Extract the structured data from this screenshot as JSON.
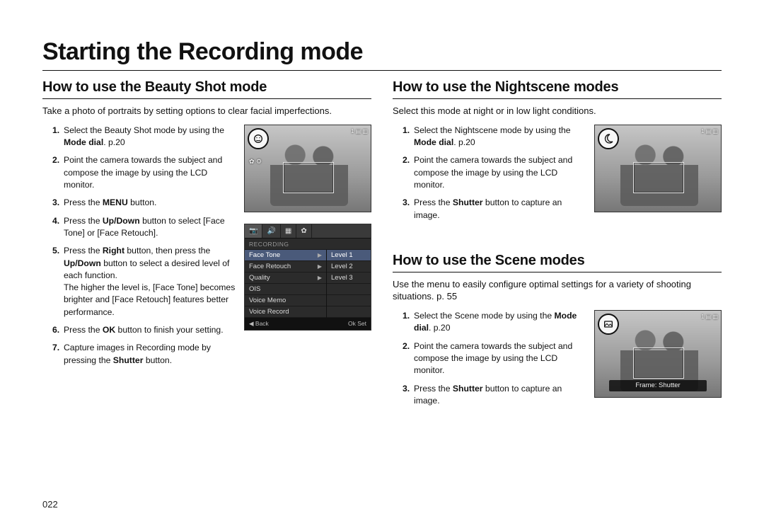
{
  "page_title": "Starting the Recording mode",
  "page_number": "022",
  "left": {
    "h2": "How to use the Beauty Shot mode",
    "intro": "Take a photo of portraits by setting options to clear facial imperfections.",
    "steps": [
      {
        "n": "1.",
        "pre": "Select the Beauty Shot mode by using the ",
        "b": "Mode dial",
        "post": ". p.20"
      },
      {
        "n": "2.",
        "pre": "Point the camera towards the subject and compose the image by using the LCD monitor.",
        "b": "",
        "post": ""
      },
      {
        "n": "3.",
        "pre": "Press the ",
        "b": "MENU",
        "post": " button."
      },
      {
        "n": "4.",
        "pre": "Press the ",
        "b": "Up/Down",
        "post": " button to select [Face Tone] or [Face Retouch]."
      },
      {
        "n": "5.",
        "pre": "Press the ",
        "b": "Right",
        "post_pre": " button, then press the ",
        "b2": "Up/Down",
        "post": " button to select a desired level of each function.",
        "extra": "The higher the level is, [Face Tone] becomes brighter and [Face Retouch] features better performance."
      },
      {
        "n": "6.",
        "pre": "Press the ",
        "b": "OK",
        "post": " button to finish your setting."
      },
      {
        "n": "7.",
        "pre": "Capture images in Recording mode by pressing the ",
        "b": "Shutter",
        "post": " button."
      }
    ],
    "menu": {
      "heading": "RECORDING",
      "rows_left": [
        "Face Tone",
        "Face Retouch",
        "Quality",
        "OIS",
        "Voice Memo",
        "Voice Record"
      ],
      "rows_right": [
        "Level 1",
        "Level 2",
        "Level 3"
      ],
      "footer_left": "◀  Back",
      "footer_right": "Ok  Set",
      "tab_icons": [
        "📷",
        "🔊",
        "▦",
        "✿"
      ]
    }
  },
  "right_top": {
    "h2": "How to use the Nightscene modes",
    "intro": "Select this mode at night or in low light conditions.",
    "steps": [
      {
        "n": "1.",
        "pre": "Select the Nightscene mode by using the ",
        "b": "Mode dial",
        "post": ". p.20"
      },
      {
        "n": "2.",
        "pre": "Point the camera towards the subject and compose the image by using the LCD monitor.",
        "b": "",
        "post": ""
      },
      {
        "n": "3.",
        "pre": "Press the ",
        "b": "Shutter",
        "post": " button to capture an image."
      }
    ]
  },
  "right_bottom": {
    "h2": "How to use the Scene modes",
    "intro": "Use the menu to easily configure optimal settings for a variety of shooting situations. p. 55",
    "steps": [
      {
        "n": "1.",
        "pre": "Select the Scene mode by using the ",
        "b": "Mode dial",
        "post": ". p.20"
      },
      {
        "n": "2.",
        "pre": "Point the camera towards the subject and compose the image by using the LCD monitor.",
        "b": "",
        "post": ""
      },
      {
        "n": "3.",
        "pre": "Press the ",
        "b": "Shutter",
        "post": " button to capture an image."
      }
    ],
    "caption": "Frame: Shutter"
  },
  "osd": {
    "top_right": "1 ▤ ▥",
    "left_icons": "✿\n⚙"
  },
  "icons": {
    "beauty": "face",
    "night": "moon",
    "scene": "SCN"
  }
}
